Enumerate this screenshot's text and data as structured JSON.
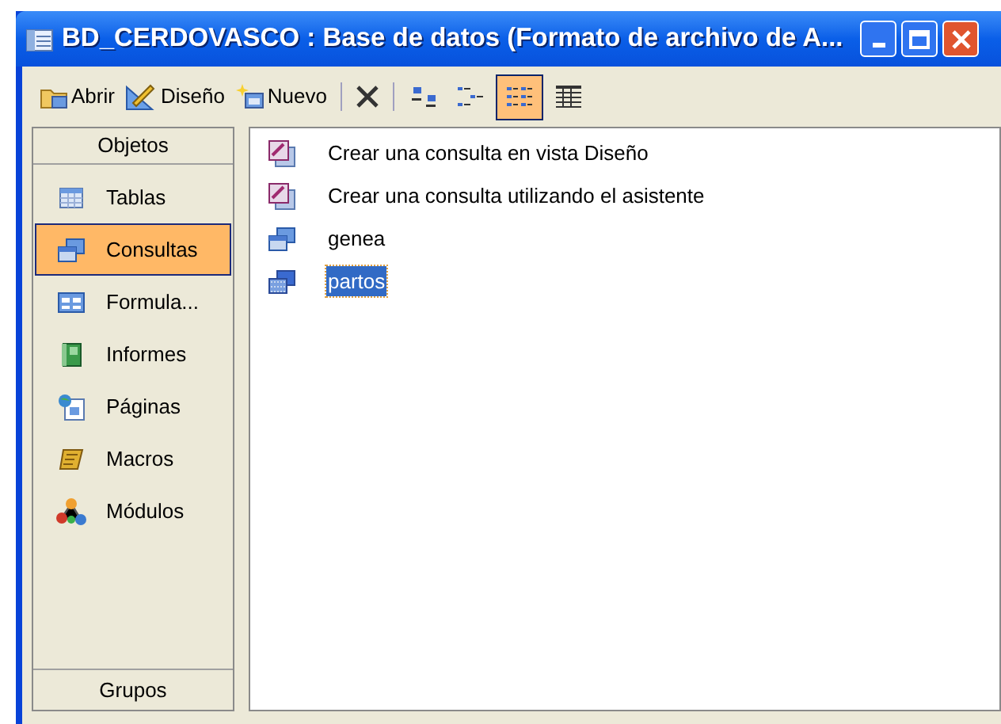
{
  "window": {
    "title": "BD_CERDOVASCO : Base de datos (Formato de archivo de A..."
  },
  "toolbar": {
    "buttons": [
      {
        "kind": "open",
        "label": "Abrir"
      },
      {
        "kind": "design",
        "label": "Diseño"
      },
      {
        "kind": "new",
        "label": "Nuevo"
      },
      {
        "kind": "delete"
      }
    ],
    "view_buttons": [
      {
        "kind": "large",
        "selected": false
      },
      {
        "kind": "small",
        "selected": false
      },
      {
        "kind": "list",
        "selected": true
      },
      {
        "kind": "details",
        "selected": false
      }
    ]
  },
  "sidebar": {
    "header": "Objetos",
    "items": [
      {
        "kind": "tables",
        "label": "Tablas",
        "selected": false
      },
      {
        "kind": "queries",
        "label": "Consultas",
        "selected": true
      },
      {
        "kind": "forms",
        "label": "Formula...",
        "selected": false
      },
      {
        "kind": "reports",
        "label": "Informes",
        "selected": false
      },
      {
        "kind": "pages",
        "label": "Páginas",
        "selected": false
      },
      {
        "kind": "macros",
        "label": "Macros",
        "selected": false
      },
      {
        "kind": "modules",
        "label": "Módulos",
        "selected": false
      }
    ],
    "footer": "Grupos"
  },
  "objects": [
    {
      "kind": "wizard",
      "label": "Crear una consulta en vista Diseño",
      "selected": false
    },
    {
      "kind": "wizard",
      "label": "Crear una consulta utilizando el asistente",
      "selected": false
    },
    {
      "kind": "select_query",
      "label": "genea",
      "selected": false
    },
    {
      "kind": "action_query",
      "label": "partos",
      "selected": true
    }
  ]
}
